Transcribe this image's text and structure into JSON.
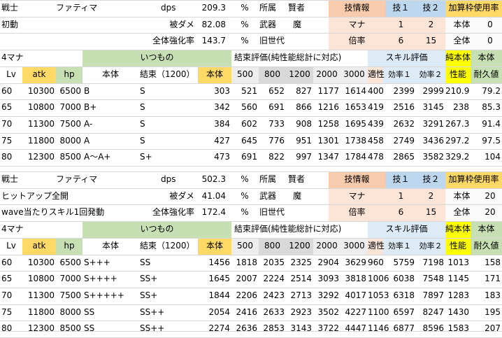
{
  "colors": {
    "yellow": "#ffd966",
    "green": "#c6e0b4",
    "peach": "#f8cbad",
    "lightblue": "#ddebf7",
    "blue": "#bdd7ee",
    "lightgray": "#ededed",
    "gray": "#d9d9d9",
    "brightyellow": "#ffff00",
    "pink": "#fce4d6"
  },
  "blocks": [
    {
      "info": {
        "class": "戦士",
        "name": "ファティマ",
        "sub1": "初動",
        "sub2": "",
        "dps_label": "dps",
        "dps_value": "209.3",
        "dps_unit": "%",
        "taken_label": "被ダメ",
        "taken_value": "82.08",
        "taken_unit": "%",
        "boost_label": "全体強化率",
        "boost_value": "143.7",
        "boost_unit": "%",
        "aff_label": "所属",
        "aff_value": "賢者",
        "weapon_label": "武器",
        "weapon_value": "魔",
        "gen_label": "旧世代"
      },
      "skillinfo": {
        "header": "技情報",
        "s1": "技１",
        "s2": "技２",
        "mana_label": "マナ",
        "mana1": "1",
        "mana2": "2",
        "mult_label": "倍率",
        "mult1": "6",
        "mult2": "15"
      },
      "slot": {
        "header": "加算枠使用率",
        "row1_label": "本体",
        "row1_value": "0",
        "row2_label": "全体",
        "row2_value": "0"
      },
      "table": {
        "mana": "4マナ",
        "usual": "いつもの",
        "bind_eval": "結束評価(純性能総計に対応)",
        "skill_eval": "スキル評価",
        "pure_top": "純本体",
        "body_top": "本体",
        "cols": [
          "Lv",
          "atk",
          "hp",
          "本体",
          "結束（1200）",
          "本体",
          "500",
          "800",
          "1200",
          "2000",
          "3000",
          "適性",
          "効率１",
          "効率２",
          "性能",
          "耐久値"
        ],
        "rows": [
          [
            "60",
            "10300",
            "6500",
            "B",
            "S",
            "303",
            "521",
            "652",
            "827",
            "1177",
            "1614",
            "400",
            "2399",
            "2999",
            "210.9",
            "79.2"
          ],
          [
            "65",
            "10800",
            "7000",
            "B+",
            "S",
            "342",
            "560",
            "691",
            "866",
            "1216",
            "1653",
            "419",
            "2516",
            "3145",
            "238",
            "85.3"
          ],
          [
            "70",
            "11300",
            "7500",
            "A-",
            "S",
            "384",
            "602",
            "733",
            "908",
            "1258",
            "1695",
            "439",
            "2632",
            "3291",
            "267.3",
            "91.4"
          ],
          [
            "75",
            "11800",
            "8000",
            "A",
            "S",
            "427",
            "645",
            "776",
            "951",
            "1301",
            "1738",
            "458",
            "2749",
            "3436",
            "297.2",
            "97.5"
          ],
          [
            "80",
            "12300",
            "8500",
            "A～A+",
            "S+",
            "473",
            "691",
            "822",
            "997",
            "1347",
            "1784",
            "478",
            "2865",
            "3582",
            "329.2",
            "104"
          ]
        ]
      }
    },
    {
      "info": {
        "class": "戦士",
        "name": "ファティマ",
        "sub1": "ヒットアップ全開",
        "sub2": "wave当たりスキル1回発動",
        "dps_label": "dps",
        "dps_value": "502.3",
        "dps_unit": "%",
        "taken_label": "被ダメ",
        "taken_value": "41.04",
        "taken_unit": "%",
        "boost_label": "全体強化率",
        "boost_value": "172.4",
        "boost_unit": "%",
        "aff_label": "所属",
        "aff_value": "賢者",
        "weapon_label": "武器",
        "weapon_value": "魔",
        "gen_label": "旧世代"
      },
      "skillinfo": {
        "header": "技情報",
        "s1": "技１",
        "s2": "技２",
        "mana_label": "マナ",
        "mana1": "1",
        "mana2": "2",
        "mult_label": "倍率",
        "mult1": "6",
        "mult2": "15"
      },
      "slot": {
        "header": "加算枠使用率",
        "row1_label": "本体",
        "row1_value": "20",
        "row2_label": "全体",
        "row2_value": "20"
      },
      "table": {
        "mana": "4マナ",
        "usual": "いつもの",
        "bind_eval": "結束評価(純性能総計に対応)",
        "skill_eval": "スキル評価",
        "pure_top": "純本体",
        "body_top": "本体",
        "cols": [
          "Lv",
          "atk",
          "hp",
          "本体",
          "結束（1200）",
          "本体",
          "500",
          "800",
          "1200",
          "2000",
          "3000",
          "適性",
          "効率１",
          "効率２",
          "性能",
          "耐久値"
        ],
        "rows": [
          [
            "60",
            "10300",
            "6500",
            "S+++",
            "SS",
            "1456",
            "1818",
            "2035",
            "2325",
            "2904",
            "3629",
            "960",
            "5759",
            "7198",
            "1013",
            "158"
          ],
          [
            "65",
            "10800",
            "7000",
            "S++++",
            "SS+",
            "1645",
            "2007",
            "2224",
            "2514",
            "3093",
            "3818",
            "1006",
            "6038",
            "7548",
            "1145",
            "171"
          ],
          [
            "70",
            "11300",
            "7500",
            "S+++++",
            "SS+",
            "1844",
            "2206",
            "2423",
            "2713",
            "3292",
            "4017",
            "1053",
            "6318",
            "7897",
            "1283",
            "183"
          ],
          [
            "75",
            "11800",
            "8000",
            "SS",
            "SS++",
            "2054",
            "2416",
            "2633",
            "2923",
            "3502",
            "4227",
            "1100",
            "6597",
            "8247",
            "1430",
            "195"
          ],
          [
            "80",
            "12300",
            "8500",
            "SS",
            "SS++",
            "2274",
            "2636",
            "2853",
            "3143",
            "3722",
            "4447",
            "1146",
            "6877",
            "8596",
            "1583",
            "207"
          ]
        ]
      }
    }
  ]
}
